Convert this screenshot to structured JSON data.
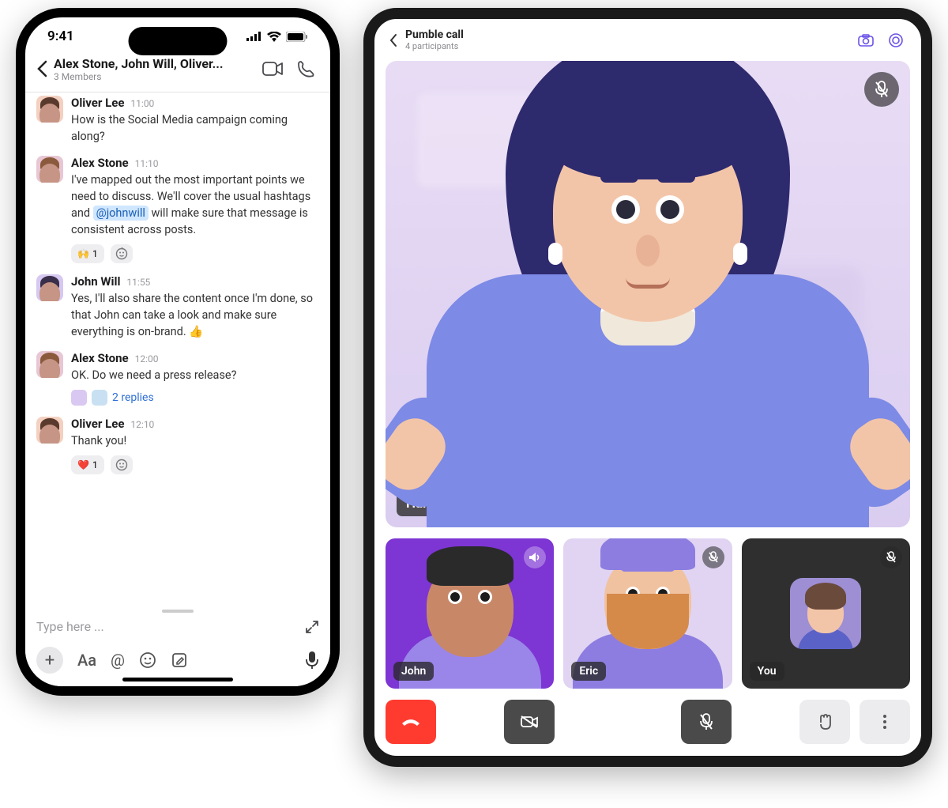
{
  "phone": {
    "status_time": "9:41",
    "header": {
      "title": "Alex Stone, John Will, Oliver...",
      "subtitle": "3 Members"
    },
    "messages": [
      {
        "author": "Oliver Lee",
        "time": "11:00",
        "avatar": "oliver",
        "text": "How is the Social Media campaign coming along?"
      },
      {
        "author": "Alex Stone",
        "time": "11:10",
        "avatar": "alex",
        "text_pre": "I've mapped out the most important points we need to discuss. We'll cover the usual hashtags and ",
        "mention": "@johnwill",
        "text_post": " will make sure that message is consistent across posts.",
        "reactions": [
          {
            "emoji": "🙌",
            "count": "1"
          }
        ],
        "add_reaction": true
      },
      {
        "author": "John Will",
        "time": "11:55",
        "avatar": "john",
        "text": "Yes, I'll also share the content once I'm done, so that John can take a look and make sure everything is on-brand. 👍"
      },
      {
        "author": "Alex Stone",
        "time": "12:00",
        "avatar": "alex",
        "text": "OK. Do we need a press release?",
        "replies": "2 replies"
      },
      {
        "author": "Oliver Lee",
        "time": "12:10",
        "avatar": "oliver",
        "text": "Thank you!",
        "reactions": [
          {
            "emoji": "❤️",
            "count": "1"
          }
        ],
        "add_reaction": true
      }
    ],
    "composer": {
      "placeholder": "Type here ..."
    }
  },
  "tablet": {
    "header": {
      "title": "Pumble call",
      "subtitle": "4 participants"
    },
    "main_participant": {
      "name": "Hannah Nelson",
      "muted": true
    },
    "thumbs": [
      {
        "name": "John",
        "variant": "john",
        "badge": "speaker"
      },
      {
        "name": "Eric",
        "variant": "eric",
        "badge": "muted"
      },
      {
        "name": "You",
        "variant": "you",
        "badge": "muted"
      }
    ]
  }
}
